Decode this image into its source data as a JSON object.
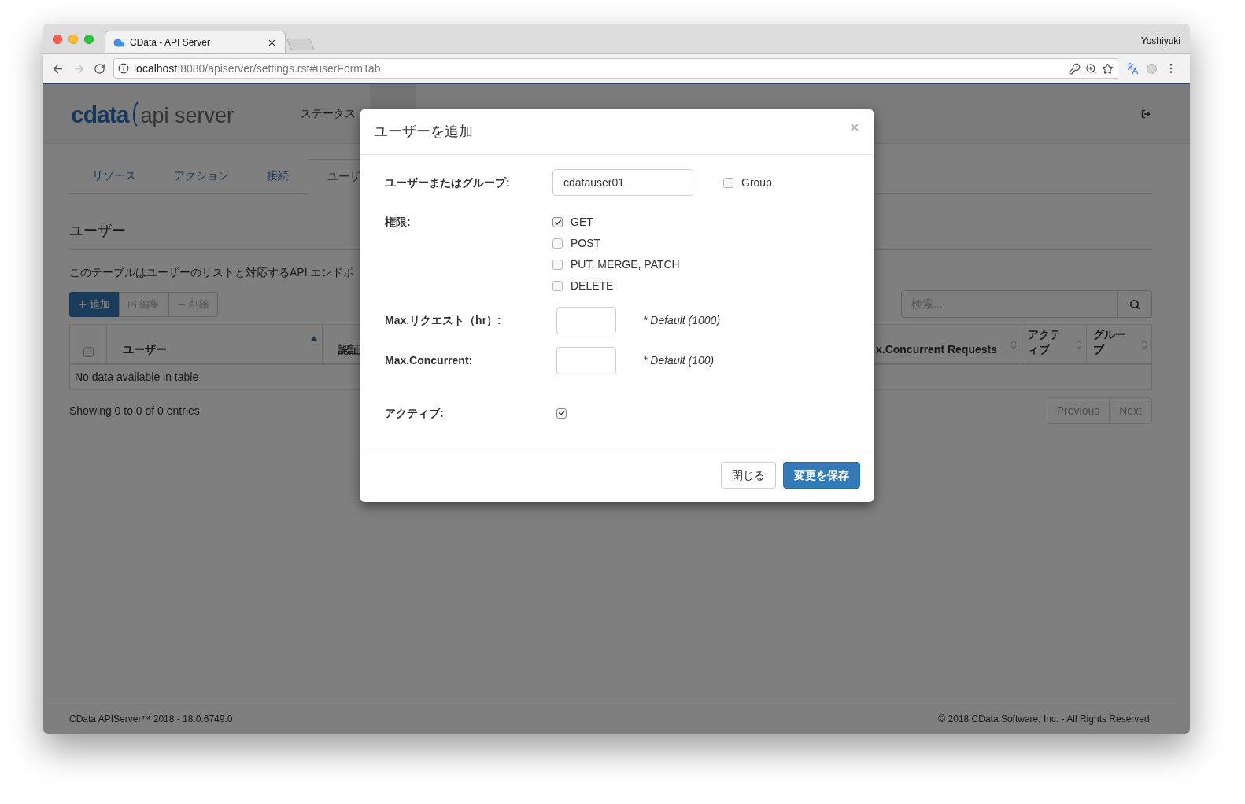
{
  "browser": {
    "tab_title": "CData - API Server",
    "url_host": "localhost",
    "url_rest": ":8080/apiserver/settings.rst#userFormTab",
    "profile": "Yoshiyuki"
  },
  "header": {
    "logo_brand": "cdata",
    "logo_product": "api server",
    "nav": [
      {
        "label": "ステータス",
        "selected": false
      },
      {
        "selected": true
      }
    ]
  },
  "tabs": [
    {
      "label": "リソース",
      "selected": false
    },
    {
      "label": "アクション",
      "selected": false
    },
    {
      "label": "接続",
      "selected": false
    },
    {
      "label": "ユーザ",
      "selected": true
    }
  ],
  "section_title": "ユーザー",
  "description": "このテーブルはユーザーのリストと対応するAPI エンドポ",
  "toolbar": [
    {
      "kind": "add",
      "label": "追加"
    },
    {
      "kind": "edit",
      "label": "編集"
    },
    {
      "kind": "remove",
      "label": "削除"
    }
  ],
  "search": {
    "placeholder": "検索..."
  },
  "table": {
    "columns": [
      {
        "kind": "checkbox",
        "checked": false
      },
      {
        "label": "ユーザー",
        "sorted": true
      },
      {
        "label": "認証"
      },
      {
        "label": "x.Concurrent Requests",
        "sorted": false
      },
      {
        "label": "アクティブ",
        "sorted": false
      },
      {
        "label": "グループ",
        "sorted": false
      }
    ],
    "empty_message": "No data available in table"
  },
  "info": "Showing 0 to 0 of 0 entries",
  "pagination": [
    {
      "label": "Previous",
      "disabled": true
    },
    {
      "label": "Next",
      "disabled": true
    }
  ],
  "footer": {
    "left": "CData APIServer™ 2018 - 18.0.6749.0",
    "right": "© 2018 CData Software, Inc. - All Rights Reserved."
  },
  "modal": {
    "title": "ユーザーを追加",
    "user_label": "ユーザーまたはグループ:",
    "user_value": "cdatauser01",
    "group": {
      "label": "Group",
      "checked": false
    },
    "permissions_label": "権限:",
    "permissions": [
      {
        "label": "GET",
        "checked": true
      },
      {
        "label": "POST",
        "checked": false
      },
      {
        "label": "PUT, MERGE, PATCH",
        "checked": false
      },
      {
        "label": "DELETE",
        "checked": false
      }
    ],
    "limits": [
      {
        "label": "Max.リクエスト（hr）:",
        "hint": "* Default (1000)"
      },
      {
        "label": "Max.Concurrent:",
        "hint": "* Default (100)"
      }
    ],
    "active_label": "アクティブ:",
    "active": true,
    "buttons": [
      {
        "kind": "secondary",
        "label": "閉じる"
      },
      {
        "kind": "primary",
        "label": "変更を保存"
      }
    ]
  }
}
